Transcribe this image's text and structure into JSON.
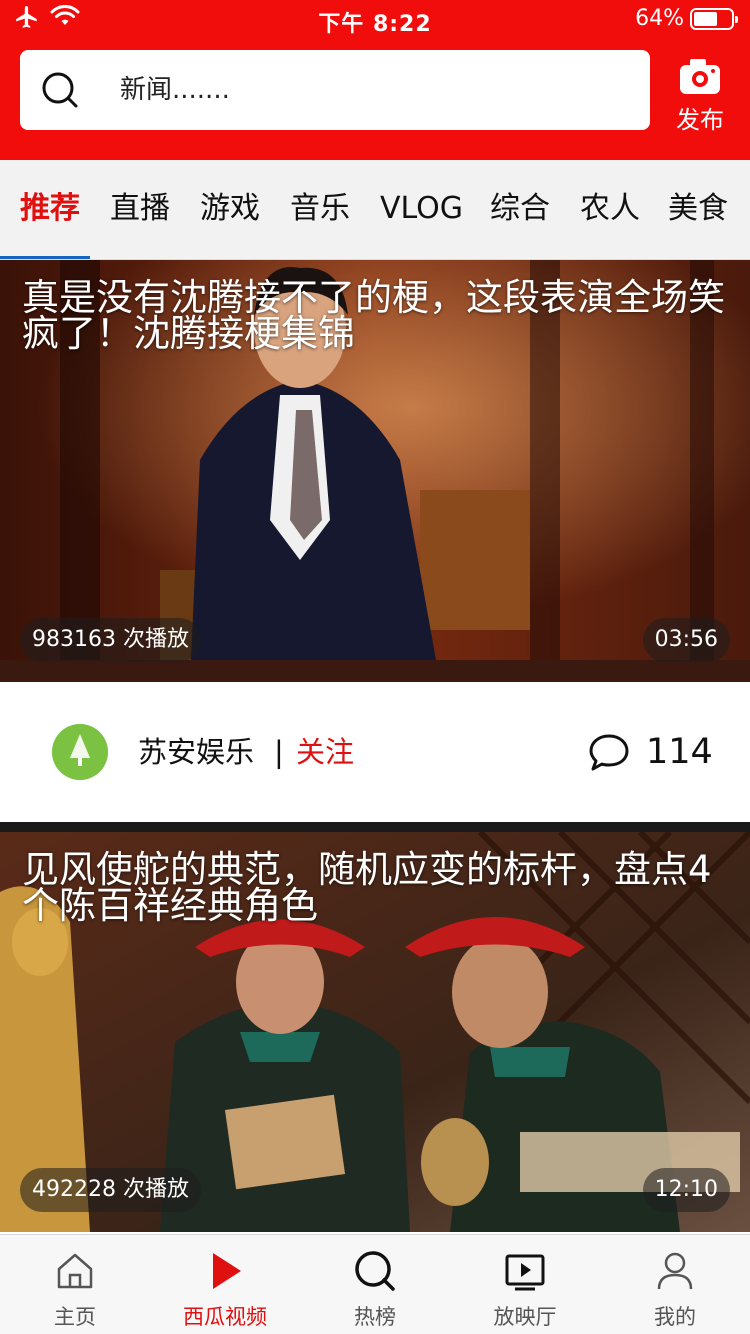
{
  "status_bar": {
    "time": "下午 8:22",
    "battery": "64%",
    "battery_level": 0.64
  },
  "search": {
    "text": "新闻.......",
    "icon": "search-icon"
  },
  "publish": {
    "label": "发布",
    "icon": "camera-icon"
  },
  "tabs": [
    {
      "label": "推荐",
      "active": true
    },
    {
      "label": "直播"
    },
    {
      "label": "游戏"
    },
    {
      "label": "音乐"
    },
    {
      "label": "VLOG"
    },
    {
      "label": "综合"
    },
    {
      "label": "农人"
    },
    {
      "label": "美食"
    }
  ],
  "videos": [
    {
      "title": "真是没有沈腾接不了的梗，这段表演全场笑疯了！沈腾接梗集锦",
      "plays": "983163 次播放",
      "duration": "03:56",
      "author": "苏安娱乐",
      "separator": "|",
      "follow": "关注",
      "comments": "114"
    },
    {
      "title": "见风使舵的典范，随机应变的标杆，盘点4个陈百祥经典角色",
      "plays": "492228 次播放",
      "duration": "12:10"
    }
  ],
  "bottom_nav": [
    {
      "label": "主页",
      "icon": "home-icon"
    },
    {
      "label": "西瓜视频",
      "icon": "play-icon",
      "active": true
    },
    {
      "label": "热榜",
      "icon": "search-icon"
    },
    {
      "label": "放映厅",
      "icon": "screen-play-icon"
    },
    {
      "label": "我的",
      "icon": "user-icon"
    }
  ],
  "colors": {
    "brand_red": "#f20d0d",
    "active_red": "#e01010",
    "tab_underline": "#1565c0"
  }
}
